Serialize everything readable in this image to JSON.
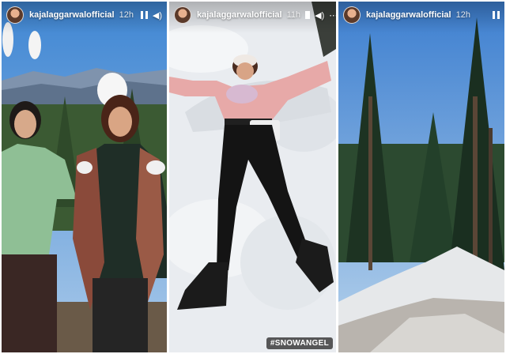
{
  "stories": [
    {
      "username": "kajalaggarwalofficial",
      "time": "12h",
      "icons": [
        "pause-icon",
        "volume-icon"
      ]
    },
    {
      "username": "kajalaggarwalofficial",
      "time": "11h",
      "icons": [
        "pause-icon",
        "volume-icon",
        "more-icon"
      ]
    },
    {
      "username": "kajalaggarwalofficial",
      "time": "12h",
      "icons": [
        "pause-icon"
      ]
    }
  ],
  "hashtag": "#SNOWANGEL",
  "colors": {
    "sky": "#5a96d8",
    "snow": "#eef1f4",
    "pine": "#1f3a24"
  }
}
